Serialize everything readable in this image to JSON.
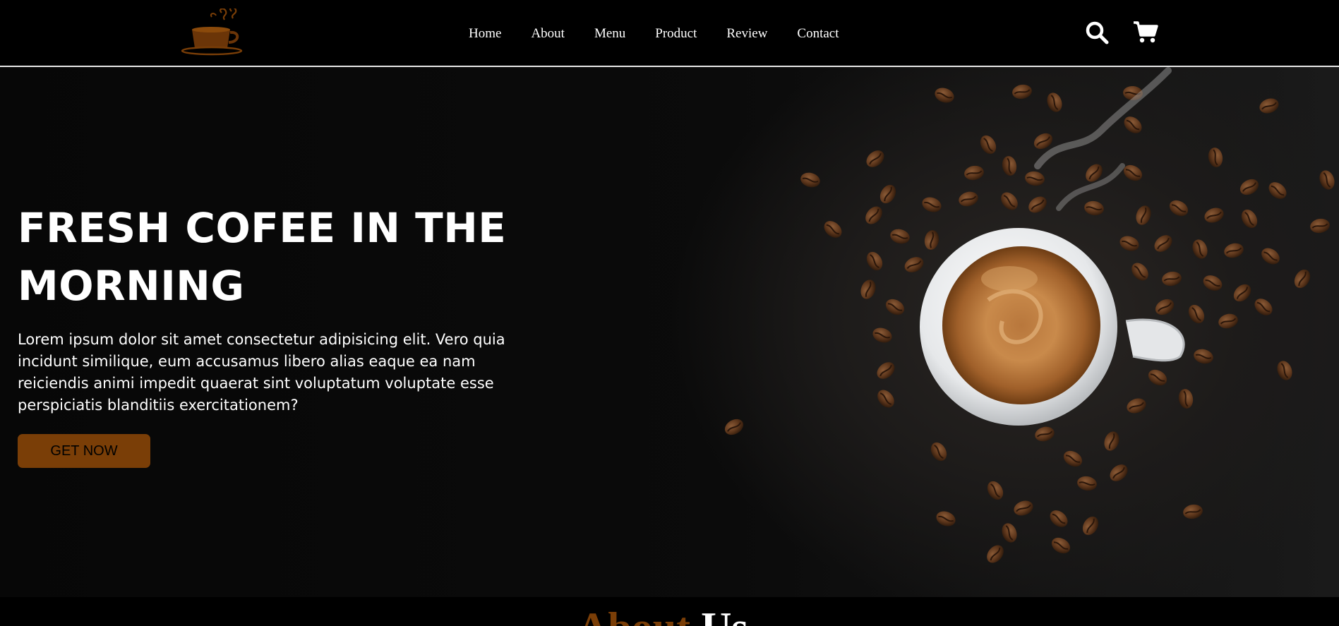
{
  "header": {
    "logo_icon": "coffee-cup-logo-icon",
    "nav": [
      {
        "label": "Home"
      },
      {
        "label": "About"
      },
      {
        "label": "Menu"
      },
      {
        "label": "Product"
      },
      {
        "label": "Review"
      },
      {
        "label": "Contact"
      }
    ],
    "icons": [
      "search-icon",
      "cart-icon"
    ]
  },
  "hero": {
    "title": "FRESH COFEE IN THE MORNING",
    "description": "Lorem ipsum dolor sit amet consectetur adipisicing elit. Vero quia incidunt similique, eum accusamus libero alias eaque ea nam reiciendis animi impedit quaerat sint voluptatum voluptate esse perspiciatis blanditiis exercitationem?",
    "button_label": "GET NOW",
    "image": "coffee-cup-and-beans-photo"
  },
  "about": {
    "heading_accent": "About",
    "heading_rest": "Us"
  },
  "colors": {
    "accent": "#7a3e07",
    "background": "#000000",
    "text": "#ffffff"
  }
}
